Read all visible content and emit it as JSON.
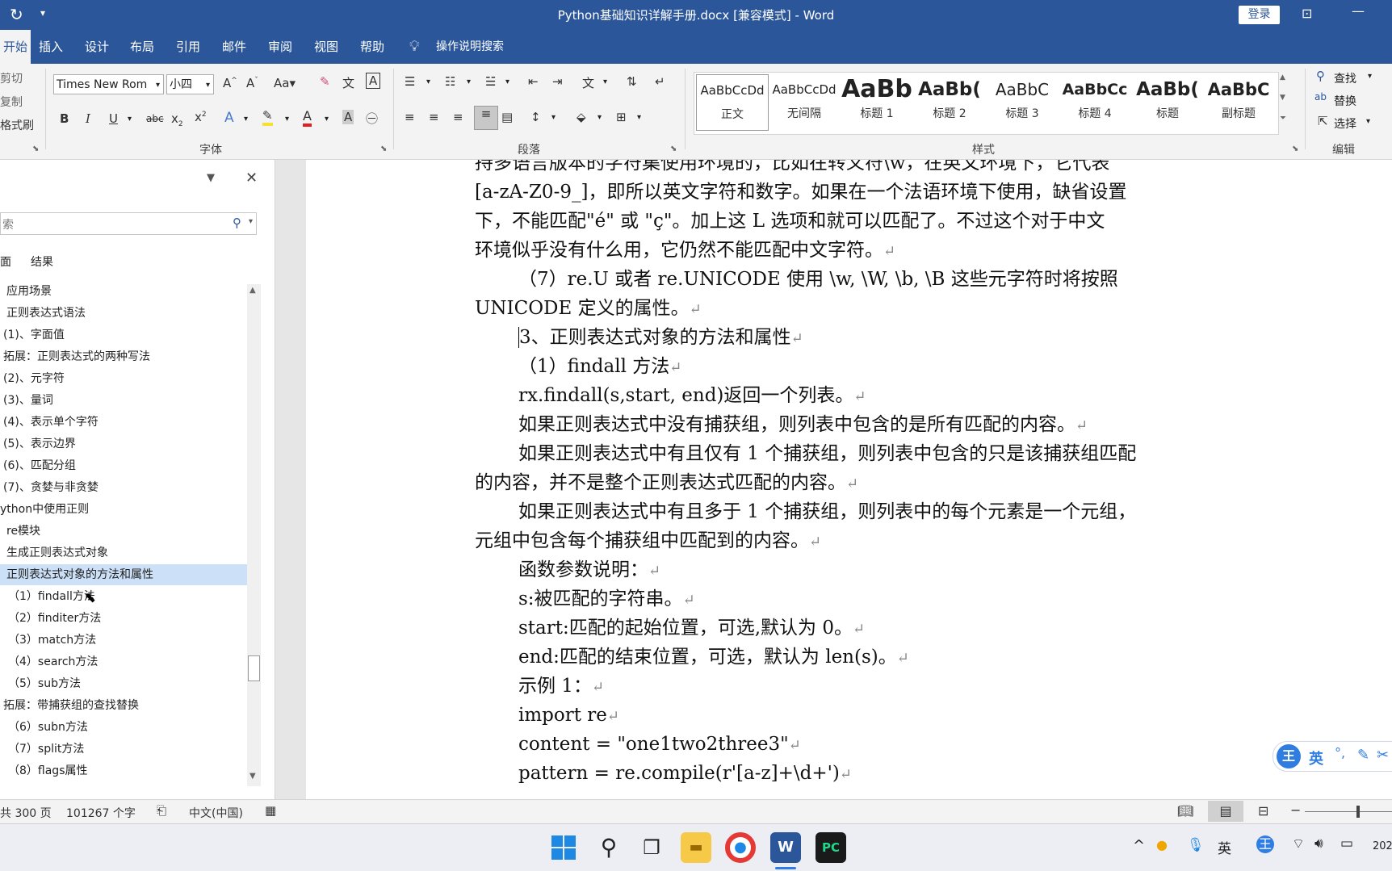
{
  "window": {
    "title": "Python基础知识详解手册.docx [兼容模式] - Word",
    "login_label": "登录",
    "colors": {
      "brand": "#2b579a",
      "ribbon_bg": "#f3f3f3",
      "nav_selected": "#cce0f7"
    }
  },
  "ribbon": {
    "tabs": [
      {
        "label": "开始"
      },
      {
        "label": "插入"
      },
      {
        "label": "设计"
      },
      {
        "label": "布局"
      },
      {
        "label": "引用"
      },
      {
        "label": "邮件"
      },
      {
        "label": "审阅"
      },
      {
        "label": "视图"
      },
      {
        "label": "帮助"
      }
    ],
    "tell_me": "操作说明搜索",
    "clipboard": {
      "cut": "剪切",
      "copy": "复制",
      "format_painter": "格式刷"
    },
    "font": {
      "name": "Times New Rom",
      "size": "小四",
      "group_label": "字体"
    },
    "paragraph": {
      "group_label": "段落"
    },
    "styles": {
      "group_label": "样式",
      "items": [
        {
          "sample": "AaBbCcDd",
          "name": "正文"
        },
        {
          "sample": "AaBbCcDd",
          "name": "无间隔"
        },
        {
          "sample": "AaBb",
          "name": "标题 1"
        },
        {
          "sample": "AaBb(",
          "name": "标题 2"
        },
        {
          "sample": "AaBbC",
          "name": "标题 3"
        },
        {
          "sample": "AaBbCc",
          "name": "标题 4"
        },
        {
          "sample": "AaBb(",
          "name": "标题"
        },
        {
          "sample": "AaBbC",
          "name": "副标题"
        }
      ]
    },
    "editing": {
      "group_label": "编辑",
      "find": "查找",
      "replace": "替换",
      "select": "选择"
    }
  },
  "nav": {
    "search_placeholder": "索",
    "tabs": [
      {
        "label": "面"
      },
      {
        "label": "结果"
      }
    ],
    "items": [
      {
        "label": "应用场景"
      },
      {
        "label": "正则表达式语法"
      },
      {
        "label": "(1)、字面值"
      },
      {
        "label": "拓展：正则表达式的两种写法"
      },
      {
        "label": "(2)、元字符"
      },
      {
        "label": "(3)、量词"
      },
      {
        "label": "(4)、表示单个字符"
      },
      {
        "label": "(5)、表示边界"
      },
      {
        "label": "(6)、匹配分组"
      },
      {
        "label": "(7)、贪婪与非贪婪"
      },
      {
        "label": "ython中使用正则"
      },
      {
        "label": "re模块"
      },
      {
        "label": "生成正则表达式对象"
      },
      {
        "label": "正则表达式对象的方法和属性"
      },
      {
        "label": "（1）findall方法"
      },
      {
        "label": "（2）finditer方法"
      },
      {
        "label": "（3）match方法"
      },
      {
        "label": "（4）search方法"
      },
      {
        "label": "（5）sub方法"
      },
      {
        "label": "拓展：带捕获组的查找替换"
      },
      {
        "label": "（6）subn方法"
      },
      {
        "label": "（7）split方法"
      },
      {
        "label": "（8）flags属性"
      }
    ]
  },
  "document": {
    "lines": [
      {
        "text": "持多语言版本的字符集使用环境的，比如在转义符\\w，在英文环境下，它代表"
      },
      {
        "text": "[a-zA-Z0-9_]，即所以英文字符和数字。如果在一个法语环境下使用，缺省设置"
      },
      {
        "text": "下，不能匹配\"é\"  或    \"ç\"。加上这 L 选项和就可以匹配了。不过这个对于中文"
      },
      {
        "text": "环境似乎没有什么用，它仍然不能匹配中文字符。"
      },
      {
        "text": "（7）re.U  或者  re.UNICODE  使用  \\w, \\W, \\b, \\B  这些元字符时将按照"
      },
      {
        "text": "UNICODE  定义的属性。"
      },
      {
        "text": "3、正则表达式对象的方法和属性"
      },
      {
        "text": "（1）findall 方法"
      },
      {
        "text": "rx.findall(s,start, end)返回一个列表。"
      },
      {
        "text": "如果正则表达式中没有捕获组，则列表中包含的是所有匹配的内容。"
      },
      {
        "text": "如果正则表达式中有且仅有 1 个捕获组，则列表中包含的只是该捕获组匹配"
      },
      {
        "text": "的内容，并不是整个正则表达式匹配的内容。"
      },
      {
        "text": "如果正则表达式中有且多于 1 个捕获组，则列表中的每个元素是一个元组，"
      },
      {
        "text": "元组中包含每个捕获组中匹配到的内容。"
      },
      {
        "text": "函数参数说明："
      },
      {
        "text": "s:被匹配的字符串。"
      },
      {
        "text": "start:匹配的起始位置，可选,默认为 0。"
      },
      {
        "text": "end:匹配的结束位置，可选，默认为 len(s)。"
      },
      {
        "text": "示例 1："
      },
      {
        "text": "import re"
      },
      {
        "text": "content = \"one1two2three3\""
      },
      {
        "text": "pattern = re.compile(r'[a-z]+\\d+')"
      }
    ]
  },
  "status": {
    "pages": "共 300 页",
    "words": "101267 个字",
    "language": "中文(中国)"
  },
  "ime": {
    "label": "英"
  },
  "taskbar": {
    "clock": "202"
  }
}
